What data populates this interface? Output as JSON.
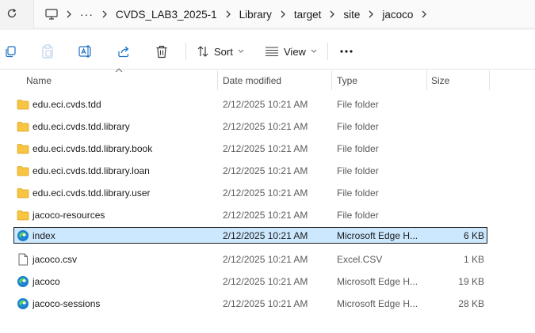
{
  "breadcrumb": {
    "items": [
      "CVDS_LAB3_2025-1",
      "Library",
      "target",
      "site",
      "jacoco"
    ]
  },
  "toolbar": {
    "sort_label": "Sort",
    "view_label": "View"
  },
  "columns": {
    "name": "Name",
    "date": "Date modified",
    "type": "Type",
    "size": "Size"
  },
  "files": [
    {
      "name": "edu.eci.cvds.tdd",
      "date": "2/12/2025 10:21 AM",
      "type": "File folder",
      "size": "",
      "icon": "folder-icon"
    },
    {
      "name": "edu.eci.cvds.tdd.library",
      "date": "2/12/2025 10:21 AM",
      "type": "File folder",
      "size": "",
      "icon": "folder-icon"
    },
    {
      "name": "edu.eci.cvds.tdd.library.book",
      "date": "2/12/2025 10:21 AM",
      "type": "File folder",
      "size": "",
      "icon": "folder-icon"
    },
    {
      "name": "edu.eci.cvds.tdd.library.loan",
      "date": "2/12/2025 10:21 AM",
      "type": "File folder",
      "size": "",
      "icon": "folder-icon"
    },
    {
      "name": "edu.eci.cvds.tdd.library.user",
      "date": "2/12/2025 10:21 AM",
      "type": "File folder",
      "size": "",
      "icon": "folder-icon"
    },
    {
      "name": "jacoco-resources",
      "date": "2/12/2025 10:21 AM",
      "type": "File folder",
      "size": "",
      "icon": "folder-icon"
    },
    {
      "name": "index",
      "date": "2/12/2025 10:21 AM",
      "type": "Microsoft Edge H...",
      "size": "6 KB",
      "icon": "edge-icon",
      "selected": true
    },
    {
      "name": "jacoco.csv",
      "date": "2/12/2025 10:21 AM",
      "type": "Excel.CSV",
      "size": "1 KB",
      "icon": "document-icon"
    },
    {
      "name": "jacoco",
      "date": "2/12/2025 10:21 AM",
      "type": "Microsoft Edge H...",
      "size": "19 KB",
      "icon": "edge-icon"
    },
    {
      "name": "jacoco-sessions",
      "date": "2/12/2025 10:21 AM",
      "type": "Microsoft Edge H...",
      "size": "28 KB",
      "icon": "edge-icon"
    }
  ],
  "colors": {
    "selection_bg": "#cce8ff",
    "folder_yellow": "#f8c542",
    "edge_blue": "#1a7fd4"
  }
}
